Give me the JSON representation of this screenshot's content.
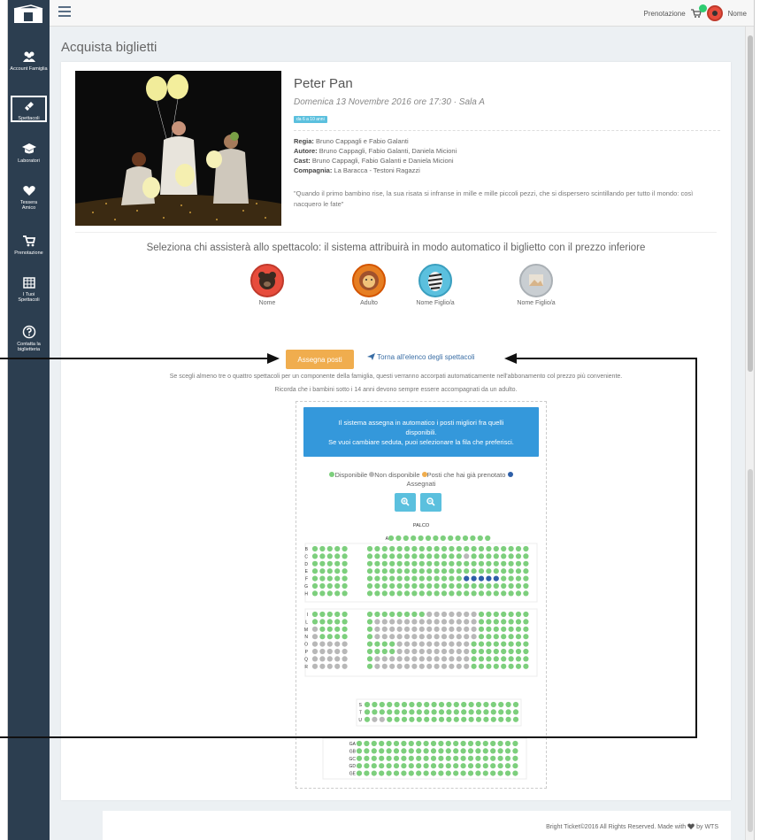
{
  "sidebar": {
    "items": [
      {
        "label": "Account Famiglia",
        "icon": "users-icon"
      },
      {
        "label": "Spettacoli",
        "icon": "ticket-icon",
        "active": true
      },
      {
        "label": "Laboratori",
        "icon": "graduation-cap-icon"
      },
      {
        "label": "Tessera Amico",
        "icon": "heart-icon"
      },
      {
        "label": "Prenotazione",
        "icon": "cart-icon"
      },
      {
        "label": "I Tuoi Spettacoli",
        "icon": "calendar-icon"
      },
      {
        "label": "Contatta la biglietteria",
        "icon": "question-icon"
      }
    ]
  },
  "topbar": {
    "prenotazione": "Prenotazione",
    "user": "Nome"
  },
  "page": {
    "title": "Acquista biglietti"
  },
  "show": {
    "title": "Peter Pan",
    "date": "Domenica 13 Novembre 2016 ore 17:30 · Sala A",
    "age": "da 6 a 10 anni",
    "regia_label": "Regia:",
    "regia": " Bruno Cappagli e Fabio Galanti",
    "autore_label": "Autore:",
    "autore": " Bruno Cappagli, Fabio Galanti, Daniela Micioni",
    "cast_label": "Cast:",
    "cast": " Bruno Cappagli, Fabio Galanti e Daniela Micioni",
    "compagnia_label": "Compagnia:",
    "compagnia": " La Baracca - Testoni Ragazzi",
    "quote": "\"Quando il primo bambino rise, la sua risata si infranse in mille e mille piccoli pezzi, che si dispersero scintillando per tutto il mondo: così nacquero le fate\""
  },
  "selection": {
    "title": "Seleziona chi assisterà allo spettacolo: il sistema attribuirà in modo automatico il biglietto con il prezzo inferiore",
    "people": [
      {
        "label": "Nome",
        "color": "#e74c3c"
      },
      {
        "label": "Adulto",
        "color": "#e67e22"
      },
      {
        "label": "Nome Figlio/a",
        "color": "#5bc0de"
      },
      {
        "label": "Nome Figlio/a",
        "color": "#bdc3c7"
      }
    ]
  },
  "actions": {
    "assegna": "Assegna posti",
    "torna": "Torna all'elenco degli spettacoli"
  },
  "info": {
    "line1": "Se scegli almeno tre o quattro spettacoli per un componente della famiglia, questi verranno accorpati automaticamente nell'abbonamento col prezzo più conveniente.",
    "line2": "Ricorda che i bambini sotto i 14 anni devono sempre essere accompagnati da un adulto."
  },
  "seatmap": {
    "info_line1": "Il sistema assegna in automatico i posti migliori fra quelli disponibili.",
    "info_line2": "Se vuoi cambiare seduta, puoi selezionare la fila che preferisci.",
    "legend": {
      "disponibile": "Disponibile",
      "non_disponibile": "Non disponibile",
      "prenotato": "Posti che hai già prenotato",
      "assegnati": "Assegnati"
    },
    "zoom_in": "+",
    "zoom_out": "−",
    "stage": "PALCO",
    "colors": {
      "available": "#7dcf7d",
      "unavailable": "#b8b8b8",
      "booked": "#f0ad4e",
      "assigned": "#2e5fa8"
    },
    "rows_top": [
      "B",
      "C",
      "D",
      "E",
      "F",
      "G",
      "H"
    ],
    "rows_mid": [
      "I",
      "L",
      "M",
      "N",
      "O",
      "P",
      "Q",
      "R"
    ],
    "rows_low": [
      "S",
      "T",
      "U"
    ],
    "rows_gallery": [
      "GA",
      "GB",
      "GC",
      "GD",
      "GE"
    ],
    "row_a": "A"
  },
  "footer": {
    "text": "Bright Ticket©2016 All Rights Reserved. Made with",
    "by": "by WTS"
  }
}
